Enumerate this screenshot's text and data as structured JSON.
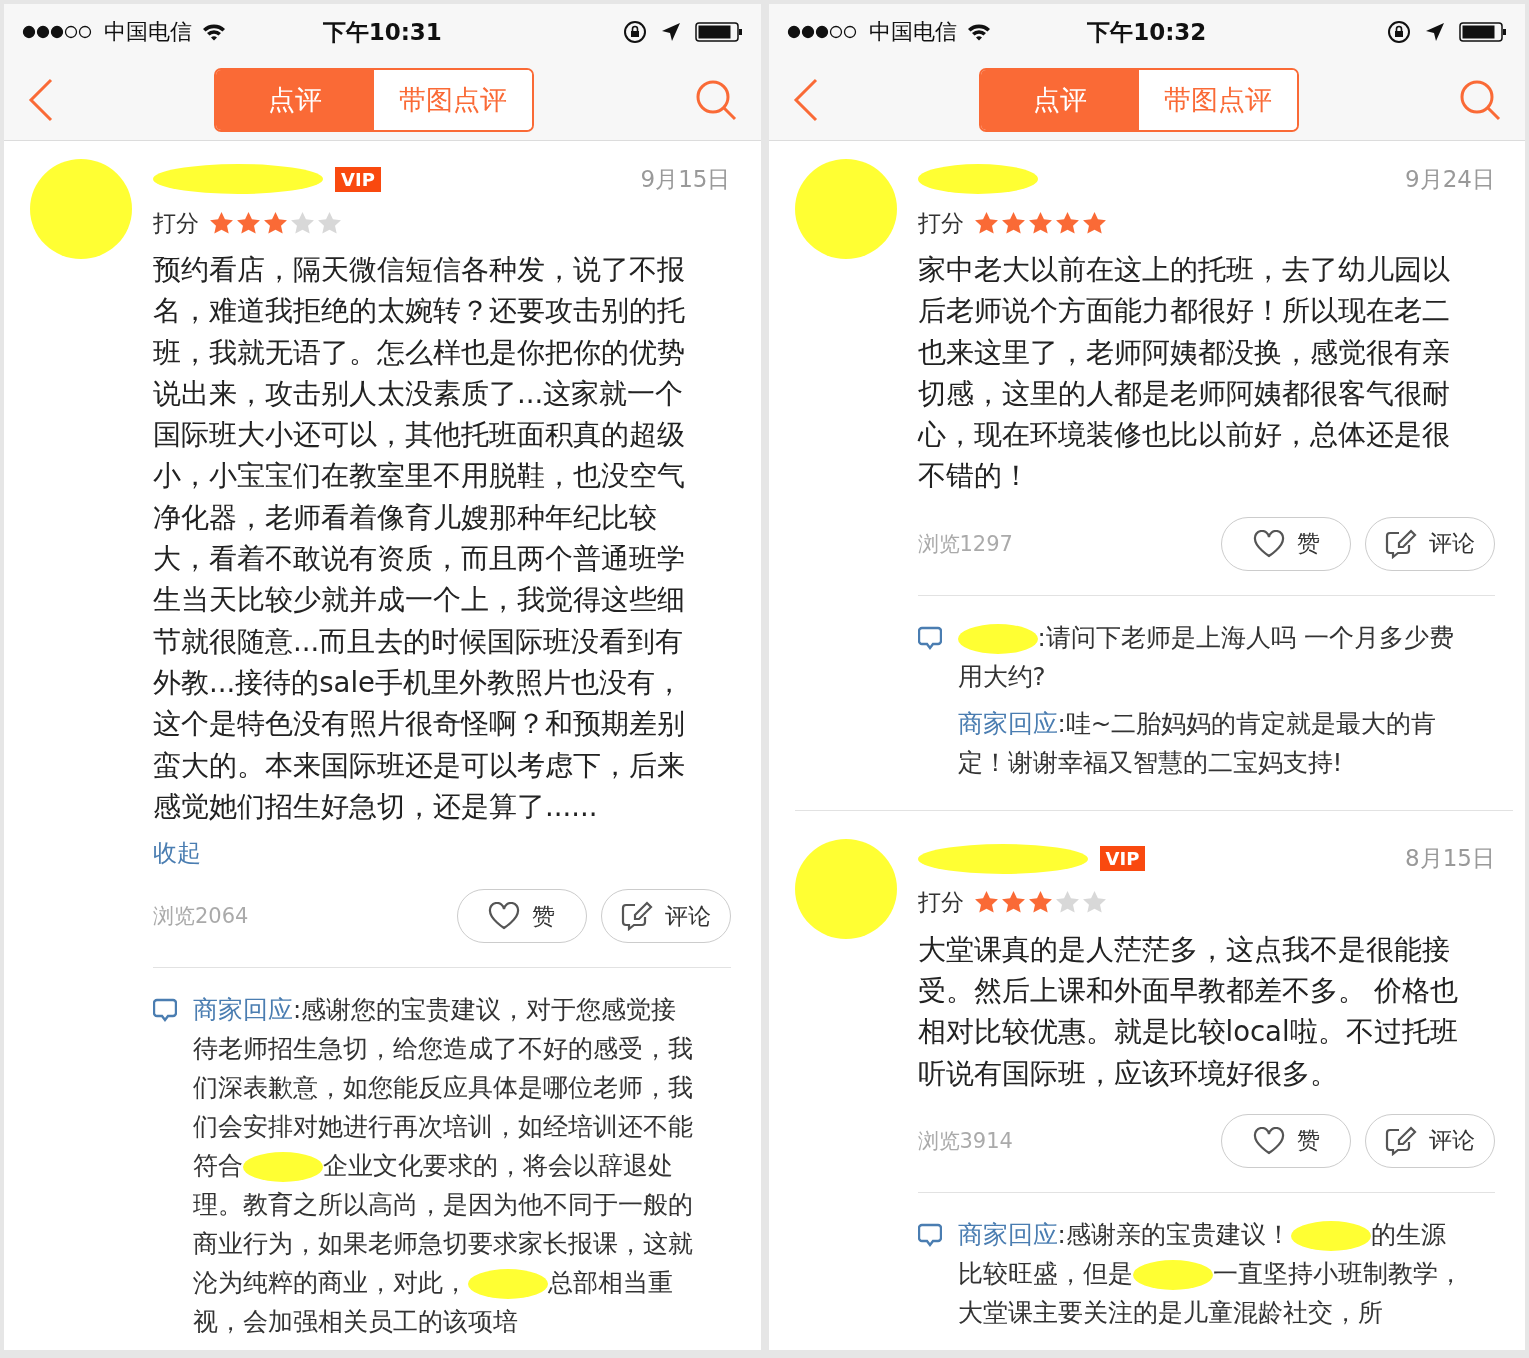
{
  "panels": [
    {
      "status_bar": {
        "carrier": "中国电信",
        "time": "下午10:31"
      },
      "tabs": [
        {
          "label": "点评",
          "selected": true
        },
        {
          "label": "带图点评",
          "selected": false
        }
      ],
      "reviews": [
        {
          "badge": "VIP",
          "date": "9月15日",
          "rating_label": "打分",
          "stars": 3,
          "body": "预约看店，隔天微信短信各种发，说了不报名，难道我拒绝的太婉转？还要攻击别的托班，我就无语了。怎么样也是你把你的优势说出来，攻击别人太没素质了...这家就一个国际班大小还可以，其他托班面积真的超级小，小宝宝们在教室里不用脱鞋，也没空气净化器，老师看着像育儿嫂那种年纪比较大，看着不敢说有资质，而且两个普通班学生当天比较少就并成一个上，我觉得这些细节就很随意...而且去的时候国际班没看到有外教...接待的sale手机里外教照片也没有，这个是特色没有照片很奇怪啊？和预期差别蛮大的。本来国际班还是可以考虑下，后来感觉她们招生好急切，还是算了......",
          "toggle": "收起",
          "views": "浏览2064",
          "actions": [
            {
              "kind": "like",
              "label": "赞"
            },
            {
              "kind": "comment",
              "label": "评论"
            }
          ],
          "replies": [
            {
              "kind": "merchant",
              "prefix": "商家回应",
              "parts": [
                {
                  "kind": "text",
                  "text": ":感谢您的宝贵建议，对于您感觉接待老师招生急切，给您造成了不好的感受，我们深表歉意，如您能反应具体是哪位老师，我们会安排对她进行再次培训，如经培训还不能符合"
                },
                {
                  "kind": "redaction"
                },
                {
                  "kind": "text",
                  "text": "企业文化要求的，将会以辞退处理。教育之所以高尚，是因为他不同于一般的商业行为，如果老师急切要求家长报课，这就沦为纯粹的商业，对此，"
                },
                {
                  "kind": "redaction"
                },
                {
                  "kind": "text",
                  "text": "总部相当重视，会加强相关员工的该项培"
                }
              ]
            }
          ]
        }
      ]
    },
    {
      "status_bar": {
        "carrier": "中国电信",
        "time": "下午10:32"
      },
      "tabs": [
        {
          "label": "点评",
          "selected": true
        },
        {
          "label": "带图点评",
          "selected": false
        }
      ],
      "reviews": [
        {
          "date": "9月24日",
          "rating_label": "打分",
          "stars": 5,
          "body": "家中老大以前在这上的托班，去了幼儿园以后老师说个方面能力都很好！所以现在老二也来这里了，老师阿姨都没换，感觉很有亲切感，这里的人都是老师阿姨都很客气很耐心，现在环境装修也比以前好，总体还是很不错的！",
          "views": "浏览1297",
          "actions": [
            {
              "kind": "like",
              "label": "赞"
            },
            {
              "kind": "comment",
              "label": "评论"
            }
          ],
          "replies": [
            {
              "kind": "user",
              "parts": [
                {
                  "kind": "redaction"
                },
                {
                  "kind": "text",
                  "text": ":请问下老师是上海人吗 一个月多少费用大约?"
                }
              ]
            },
            {
              "kind": "merchant",
              "prefix": "商家回应",
              "parts": [
                {
                  "kind": "text",
                  "text": ":哇~二胎妈妈的肯定就是最大的肯定！谢谢幸福又智慧的二宝妈支持!"
                }
              ]
            }
          ]
        },
        {
          "badge": "VIP",
          "date": "8月15日",
          "rating_label": "打分",
          "stars": 3,
          "body": "大堂课真的是人茫茫多，这点我不是很能接受。然后上课和外面早教都差不多。 价格也相对比较优惠。就是比较local啦。不过托班听说有国际班，应该环境好很多。",
          "views": "浏览3914",
          "actions": [
            {
              "kind": "like",
              "label": "赞"
            },
            {
              "kind": "comment",
              "label": "评论"
            }
          ],
          "replies": [
            {
              "kind": "merchant",
              "prefix": "商家回应",
              "parts": [
                {
                  "kind": "text",
                  "text": ":感谢亲的宝贵建议！"
                },
                {
                  "kind": "redaction"
                },
                {
                  "kind": "text",
                  "text": "的生源比较旺盛，但是"
                },
                {
                  "kind": "redaction"
                },
                {
                  "kind": "text",
                  "text": "一直坚持小班制教学，大堂课主要关注的是儿童混龄社交，所"
                }
              ]
            }
          ]
        }
      ]
    }
  ]
}
